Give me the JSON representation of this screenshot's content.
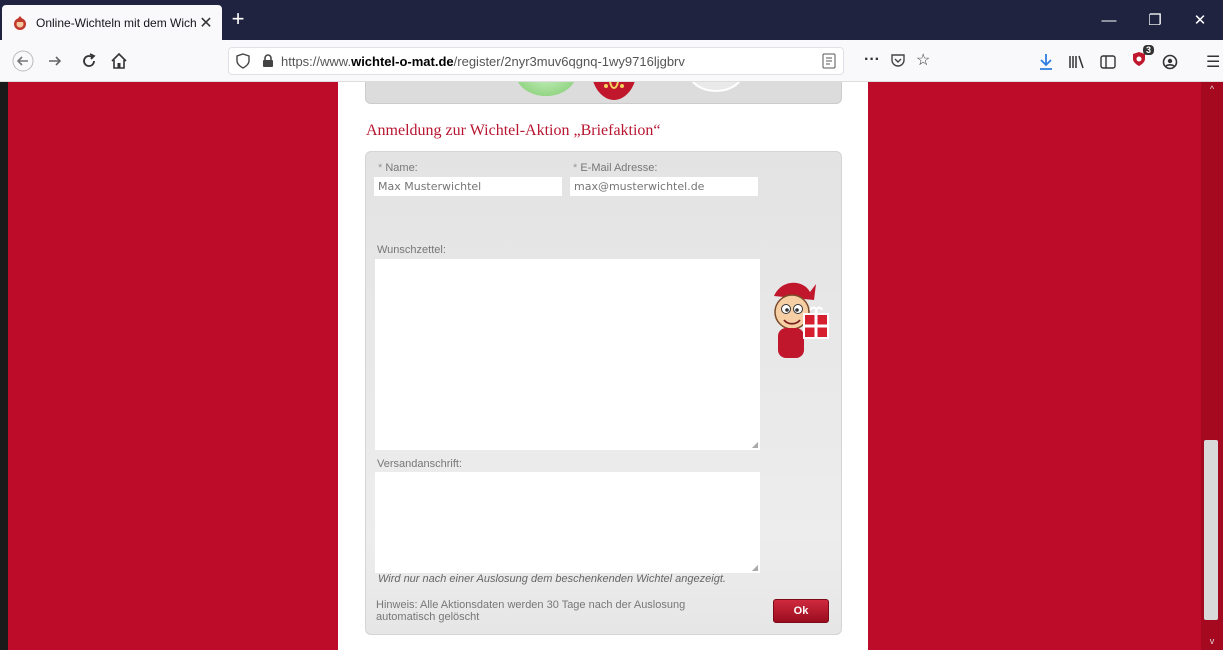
{
  "browser": {
    "tab_title": "Online-Wichteln mit dem Wichtel-o-mat",
    "url_prefix": "https://www.",
    "url_domain": "wichtel-o-mat.de",
    "url_path": "/register/2nyr3muv6qgnq-1wy9716ljgbrv",
    "extension_badge": "3",
    "more_label": "···"
  },
  "form": {
    "heading": "Anmeldung zur Wichtel-Aktion „Briefaktion“",
    "name_label": "Name:",
    "email_label": "E-Mail Adresse:",
    "required_mark": "*",
    "name_placeholder": "Max Musterwichtel",
    "email_placeholder": "max@musterwichtel.de",
    "wishlist_label": "Wunschzettel:",
    "address_label": "Versandanschrift:",
    "address_hint": "Wird nur nach einer Auslosung dem beschenkenden Wichtel angezeigt.",
    "note": "Hinweis: Alle Aktionsdaten werden 30 Tage nach der Auslosung automatisch gelöscht",
    "ok_label": "Ok"
  }
}
